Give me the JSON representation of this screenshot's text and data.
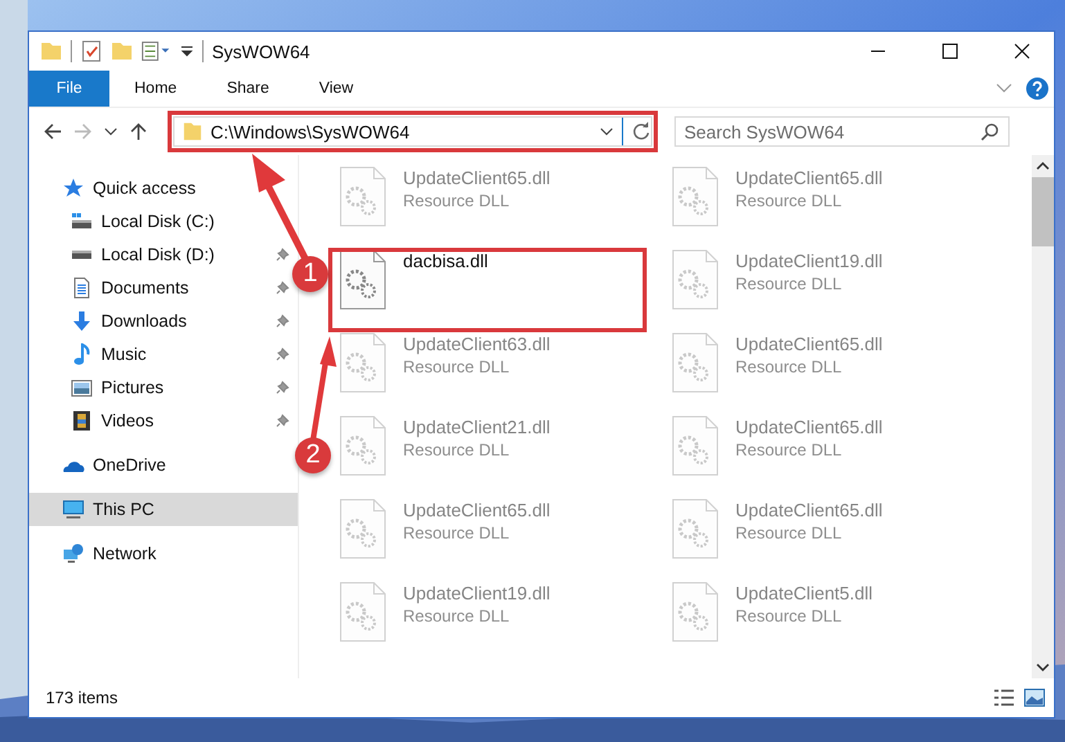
{
  "window": {
    "title": "SysWOW64"
  },
  "ribbon_tabs": [
    {
      "label": "File",
      "kind": "file"
    },
    {
      "label": "Home",
      "kind": "tab"
    },
    {
      "label": "Share",
      "kind": "tab"
    },
    {
      "label": "View",
      "kind": "tab"
    }
  ],
  "address_bar": {
    "path": "C:\\Windows\\SysWOW64"
  },
  "search": {
    "placeholder": "Search SysWOW64"
  },
  "sidebar": {
    "items": [
      {
        "label": "Quick access",
        "kind": "star",
        "selected": false,
        "children": [
          {
            "label": "Local Disk (C:)",
            "kind": "disk-c",
            "pinned": false
          },
          {
            "label": "Local Disk (D:)",
            "kind": "disk",
            "pinned": true
          },
          {
            "label": "Documents",
            "kind": "documents",
            "pinned": true
          },
          {
            "label": "Downloads",
            "kind": "downloads",
            "pinned": true
          },
          {
            "label": "Music",
            "kind": "music",
            "pinned": true
          },
          {
            "label": "Pictures",
            "kind": "pictures",
            "pinned": true
          },
          {
            "label": "Videos",
            "kind": "videos",
            "pinned": true
          }
        ]
      },
      {
        "label": "OneDrive",
        "kind": "cloud",
        "selected": false
      },
      {
        "label": "This PC",
        "kind": "pc",
        "selected": true
      },
      {
        "label": "Network",
        "kind": "network",
        "selected": false
      }
    ]
  },
  "files": [
    {
      "name": "UpdateClient65.dll",
      "type": "Resource DLL",
      "blurred": true
    },
    {
      "name": "UpdateClient65.dll",
      "type": "Resource DLL",
      "blurred": true
    },
    {
      "name": "dacbisa.dll",
      "blurred": false
    },
    {
      "name": "UpdateClient19.dll",
      "type": "Resource DLL",
      "blurred": true
    },
    {
      "name": "UpdateClient63.dll",
      "type": "Resource DLL",
      "blurred": true
    },
    {
      "name": "UpdateClient65.dll",
      "type": "Resource DLL",
      "blurred": true
    },
    {
      "name": "UpdateClient21.dll",
      "type": "Resource DLL",
      "blurred": true
    },
    {
      "name": "UpdateClient65.dll",
      "type": "Resource DLL",
      "blurred": true
    },
    {
      "name": "UpdateClient65.dll",
      "type": "Resource DLL",
      "blurred": true
    },
    {
      "name": "UpdateClient65.dll",
      "type": "Resource DLL",
      "blurred": true
    },
    {
      "name": "UpdateClient19.dll",
      "type": "Resource DLL",
      "blurred": true
    },
    {
      "name": "UpdateClient5.dll",
      "type": "Resource DLL",
      "blurred": true
    }
  ],
  "status_bar": {
    "item_count": "173 items"
  },
  "annotations": [
    {
      "number": "1"
    },
    {
      "number": "2"
    }
  ]
}
